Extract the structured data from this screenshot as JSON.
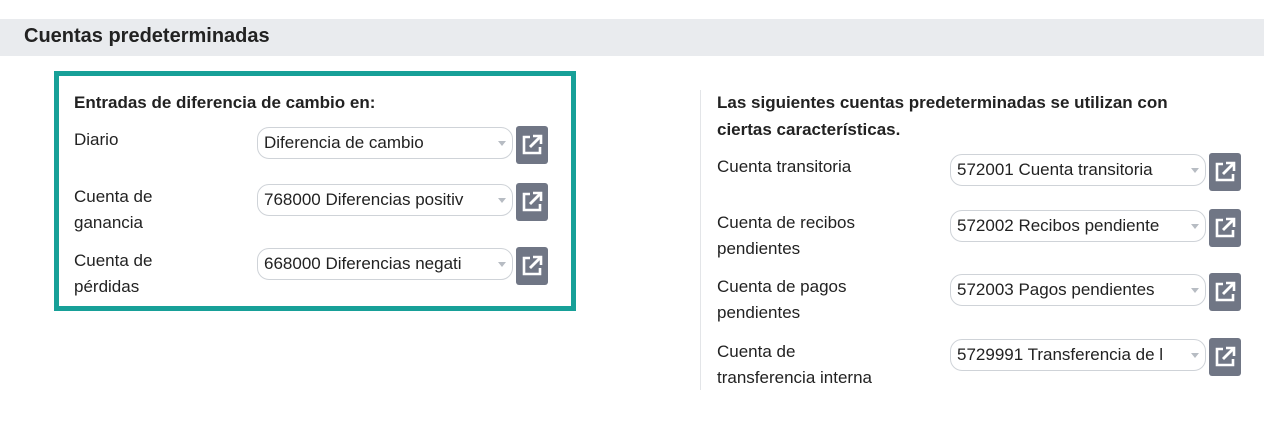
{
  "section": {
    "title": "Cuentas predeterminadas"
  },
  "left": {
    "title": "Entradas de diferencia de cambio en:",
    "fields": [
      {
        "label_line1": "Diario",
        "label_line2": "",
        "value": "Diferencia de cambio"
      },
      {
        "label_line1": "Cuenta de",
        "label_line2": "ganancia",
        "value": "768000 Diferencias positiv"
      },
      {
        "label_line1": "Cuenta de",
        "label_line2": "pérdidas",
        "value": "668000 Diferencias negati"
      }
    ]
  },
  "right": {
    "title_line1": "Las siguientes cuentas predeterminadas se utilizan con",
    "title_line2": "ciertas características.",
    "fields": [
      {
        "label_line1": "Cuenta transitoria",
        "label_line2": "",
        "value": "572001 Cuenta transitoria"
      },
      {
        "label_line1": "Cuenta de recibos",
        "label_line2": "pendientes",
        "value": "572002 Recibos pendiente"
      },
      {
        "label_line1": "Cuenta de pagos",
        "label_line2": "pendientes",
        "value": "572003 Pagos pendientes"
      },
      {
        "label_line1": "Cuenta de",
        "label_line2": "transferencia interna",
        "value": "5729991 Transferencia de l"
      }
    ]
  },
  "icons": {
    "external_link": "external-link-icon",
    "dropdown": "chevron-down-icon"
  },
  "colors": {
    "highlight": "#17a098",
    "header_bg": "#e9ebee",
    "button_bg": "#707685"
  }
}
